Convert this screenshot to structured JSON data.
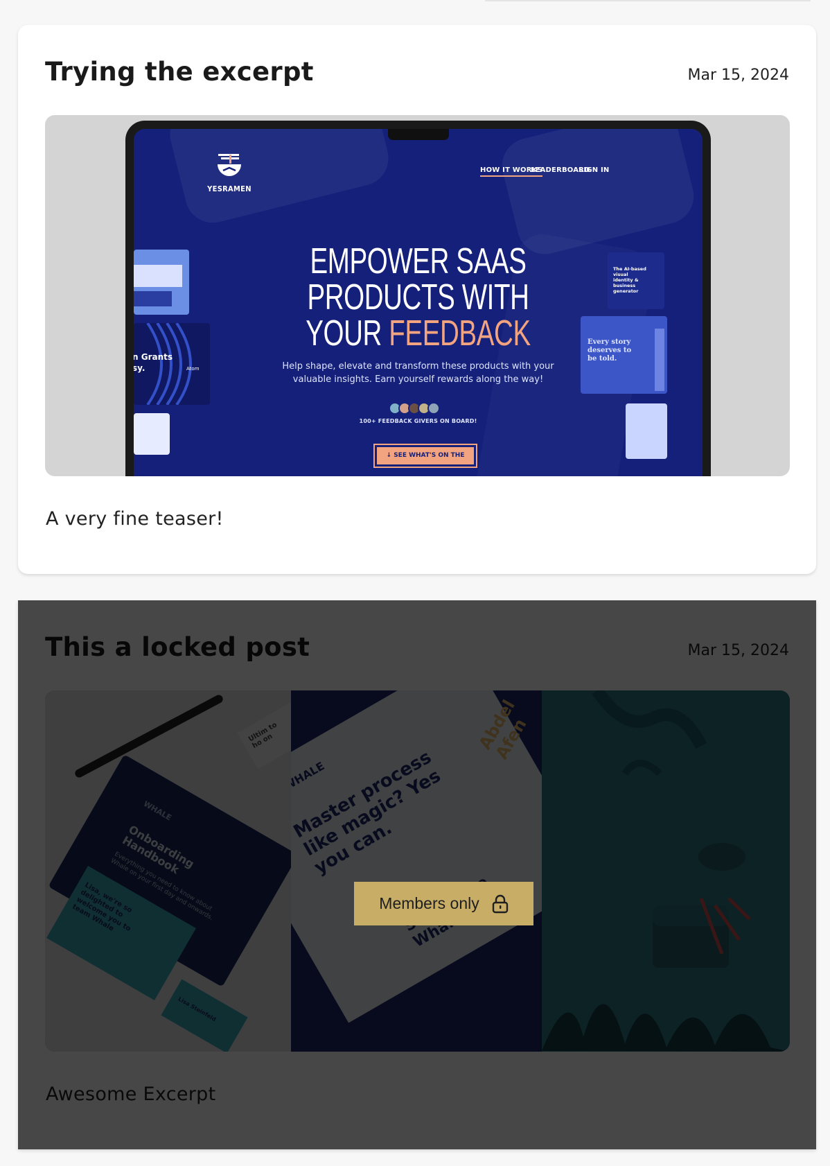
{
  "posts": [
    {
      "title": "Trying the excerpt",
      "date": "Mar 15, 2024",
      "excerpt": "A very fine teaser!",
      "image": {
        "brand": "YESRAMEN",
        "nav": [
          "HOW IT WORKS",
          "LEADERBOARD",
          "SIGN IN"
        ],
        "headline_line1": "EMPOWER SAAS",
        "headline_line2": "PRODUCTS WITH",
        "headline_line3_a": "YOUR",
        "headline_line3_b": "FEEDBACK",
        "subtext_line1": "Help shape, elevate and transform these products with your",
        "subtext_line2": "valuable insights. Earn yourself rewards along the way!",
        "givers": "100+ FEEDBACK GIVERS ON BOARD!",
        "cta": "↓ SEE WHAT'S ON THE MENU ↓",
        "tile_grants": "n Grants",
        "tile_sy": "sy.",
        "tile_atom": "Atom",
        "tile_ai": "The AI-based visual identity & business generator",
        "tile_story": "Every story deserves to be told.",
        "accent_color": "#f2a37f",
        "bg_color": "#14207a"
      }
    },
    {
      "title": "This a locked post",
      "date": "Mar 15, 2024",
      "excerpt": "Awesome Excerpt",
      "locked": true,
      "lock_label": "Members only",
      "lock_icon": "lock-icon",
      "lock_color": "#c8ad66",
      "image": {
        "brand": "WHALE",
        "handbook_title": "Onboarding Handbook",
        "handbook_sub": "Everything you need to know about Whale on your first day and onwards.",
        "poster_text": "Master process like magic? Yes you can.",
        "poster_text_2": "Simply use Whale",
        "card_text": "Lisa, we're so delighted to welcome you to team Whale",
        "name_1": "Abdel Afen",
        "name_2": "Lisa Steinfeld",
        "ultim": "Ultim to ho on"
      }
    }
  ]
}
